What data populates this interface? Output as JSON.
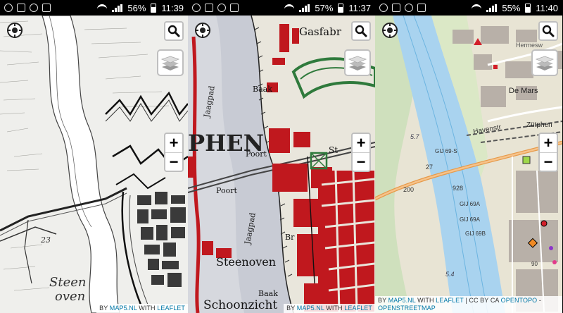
{
  "screens": [
    {
      "status": {
        "battery": "56%",
        "time": "11:39"
      },
      "map_labels": {
        "place1": "Steen",
        "place2": "oven",
        "num": "23"
      },
      "attribution": {
        "prefix": "BY",
        "source": "MAP5.NL",
        "mid": "WITH",
        "lib": "LEAFLET"
      }
    },
    {
      "status": {
        "battery": "57%",
        "time": "11:37"
      },
      "map_labels": {
        "gasfabr": "Gasfabr",
        "jaagpad1": "Jaagpad",
        "baak1": "Baak",
        "phen": "PHEN",
        "poort1": "Poort",
        "poort2": "Poort",
        "jaagpad2": "Jaagpad",
        "br": "Br",
        "steenoven": "Steenoven",
        "baak2": "Baak",
        "schoonzicht": "Schoonzicht",
        "st": "St"
      },
      "attribution": {
        "prefix": "BY",
        "source": "MAP5.NL",
        "mid": "WITH",
        "lib": "LEAFLET"
      }
    },
    {
      "status": {
        "battery": "55%",
        "time": "11:40"
      },
      "map_labels": {
        "hermesweg": "Hermesw",
        "demars": "De Mars",
        "havenstr": "Havenstr",
        "zutphen": "Zütphen",
        "e57": "5.7",
        "gij69s": "GIJ 69-S",
        "n27": "27",
        "n928": "928",
        "n200": "200",
        "gij69a1": "GIJ 69A",
        "gij69a2": "GIJ 69A",
        "gij69b": "GIJ 69B",
        "e54": "5.4",
        "n90": "90"
      },
      "attribution": {
        "prefix": "BY",
        "source": "MAP5.NL",
        "mid": "WITH",
        "lib": "LEAFLET",
        "sep": "| CC BY CA",
        "topo": "OPENTOPO",
        "dash": "-",
        "osm": "OPENSTREETMAP"
      }
    }
  ]
}
